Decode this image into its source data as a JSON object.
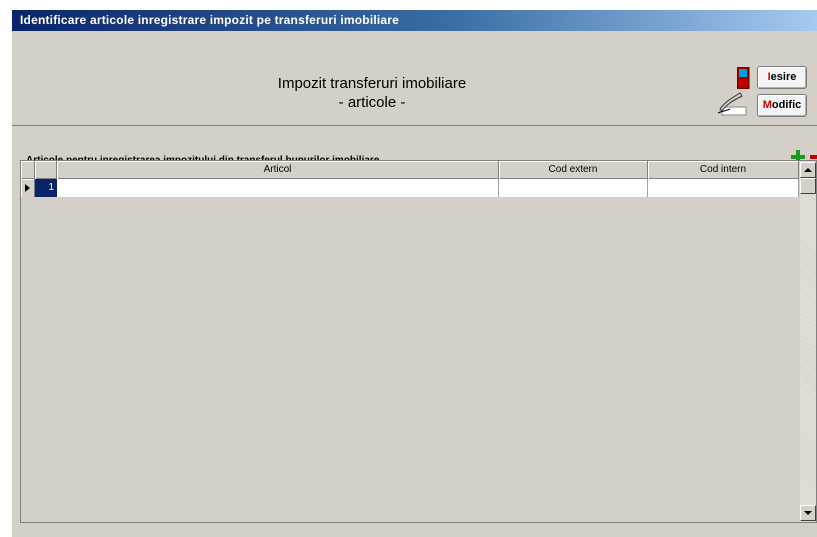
{
  "window": {
    "title": "Identificare articole inregistrare impozit pe transferuri imobiliare"
  },
  "header": {
    "title": "Impozit transferuri imobiliare",
    "subtitle": "- articole -"
  },
  "buttons": {
    "iesire": {
      "hotkey": "I",
      "rest": "esire"
    },
    "modific": {
      "hotkey": "M",
      "rest": "odific"
    }
  },
  "section": {
    "label": "Articole pentru inregistrarea impozitului din transferul bunurilor imobiliare"
  },
  "grid": {
    "columns": [
      "Articol",
      "Cod extern",
      "Cod intern"
    ],
    "rows": [
      {
        "num": "1",
        "articol": "",
        "cod_extern": "",
        "cod_intern": ""
      }
    ]
  },
  "colors": {
    "title_bar": "#0a246a",
    "selected_row": "#0a246a",
    "hotkey": "#d00000",
    "add": "#1a9a1a",
    "remove": "#c00000"
  },
  "icons": [
    "door-exit-icon",
    "pen-write-icon",
    "add-row-icon",
    "remove-row-icon",
    "row-indicator-arrow-icon"
  ]
}
